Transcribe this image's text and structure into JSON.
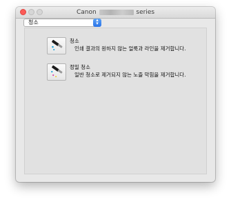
{
  "window": {
    "title_prefix": "Canon",
    "title_suffix": "series"
  },
  "selector": {
    "value": "청소"
  },
  "tools": [
    {
      "name": "청소",
      "description": "인쇄 결과의 원하지 않는 얼룩과 라인을 제거합니다."
    },
    {
      "name": "정밀 청소",
      "description": "일반 청소로 제거되지 않는 노즐 막힘을 제거합니다."
    }
  ],
  "colors": {
    "close_light": "#fc5b57",
    "select_arrow": "#2a73e8",
    "ink_cyan": "#1aa3d9",
    "ink_magenta": "#d6309a",
    "ink_yellow": "#f2c81c",
    "ink_black": "#222222"
  },
  "icons": [
    "cleaning-icon",
    "deep-cleaning-icon",
    "chevron-updown-icon"
  ]
}
